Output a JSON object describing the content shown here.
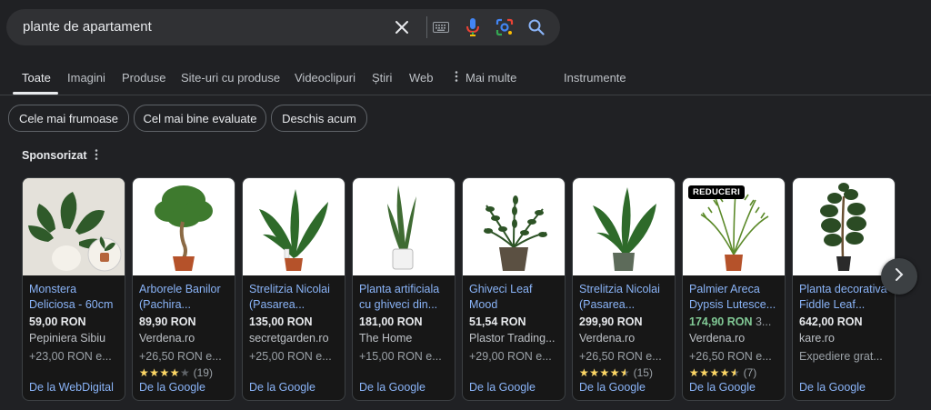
{
  "search": {
    "query": "plante de apartament",
    "clear_icon": "close-icon",
    "keyboard_icon": "keyboard-icon",
    "voice_icon": "microphone-icon",
    "lens_icon": "camera-lens-icon",
    "search_icon": "search-icon"
  },
  "tabs": [
    {
      "label": "Toate",
      "active": true
    },
    {
      "label": "Imagini"
    },
    {
      "label": "Produse"
    },
    {
      "label": "Site-uri cu produse"
    },
    {
      "label": "Videoclipuri"
    },
    {
      "label": "Știri"
    },
    {
      "label": "Web"
    },
    {
      "label": "Mai multe",
      "icon": "more-vert-icon"
    },
    {
      "label": "Instrumente"
    }
  ],
  "chips": [
    "Cele mai frumoase",
    "Cel mai bine evaluate",
    "Deschis acum"
  ],
  "sponsored": {
    "label": "Sponsorizat"
  },
  "products": [
    {
      "title_line1": "Monstera",
      "title_line2": "Deliciosa - 60cm",
      "price": "59,00 RON",
      "store": "Pepiniera Sibiu",
      "shipping": "+23,00 RON e...",
      "source": "De la WebDigital"
    },
    {
      "title_line1": "Arborele Banilor",
      "title_line2": "(Pachira...",
      "price": "89,90 RON",
      "store": "Verdena.ro",
      "shipping": "+26,50 RON e...",
      "rating": 4.0,
      "rating_count": "(19)",
      "source": "De la Google"
    },
    {
      "title_line1": "Strelitzia Nicolai",
      "title_line2": "(Pasarea...",
      "price": "135,00 RON",
      "store": "secretgarden.ro",
      "shipping": "+25,00 RON e...",
      "source": "De la Google"
    },
    {
      "title_line1": "Planta artificiala",
      "title_line2": "cu ghiveci din...",
      "price": "181,00 RON",
      "store": "The Home",
      "shipping": "+15,00 RON e...",
      "source": "De la Google"
    },
    {
      "title_line1": "Ghiveci Leaf",
      "title_line2": "Mood",
      "price": "51,54 RON",
      "store": "Plastor Trading...",
      "shipping": "+29,00 RON e...",
      "source": "De la Google"
    },
    {
      "title_line1": "Strelitzia Nicolai",
      "title_line2": "(Pasarea...",
      "price": "299,90 RON",
      "store": "Verdena.ro",
      "shipping": "+26,50 RON e...",
      "rating": 4.5,
      "rating_count": "(15)",
      "source": "De la Google"
    },
    {
      "badge": "REDUCERI",
      "title_line1": "Palmier Areca",
      "title_line2": "Dypsis Lutesce...",
      "price": "174,90 RON",
      "price_sale": true,
      "old_price": "3...",
      "store": "Verdena.ro",
      "shipping": "+26,50 RON e...",
      "rating": 4.5,
      "rating_count": "(7)",
      "source": "De la Google"
    },
    {
      "title_line1": "Planta decorativa",
      "title_line2": "Fiddle Leaf...",
      "price": "642,00 RON",
      "store": "kare.ro",
      "shipping": "Expediere grat...",
      "source": "De la Google"
    }
  ],
  "next_button": {
    "icon": "chevron-right-icon"
  },
  "colors": {
    "background": "#202124",
    "link": "#8ab4f8",
    "sale": "#81c995",
    "star": "#fdd663"
  }
}
